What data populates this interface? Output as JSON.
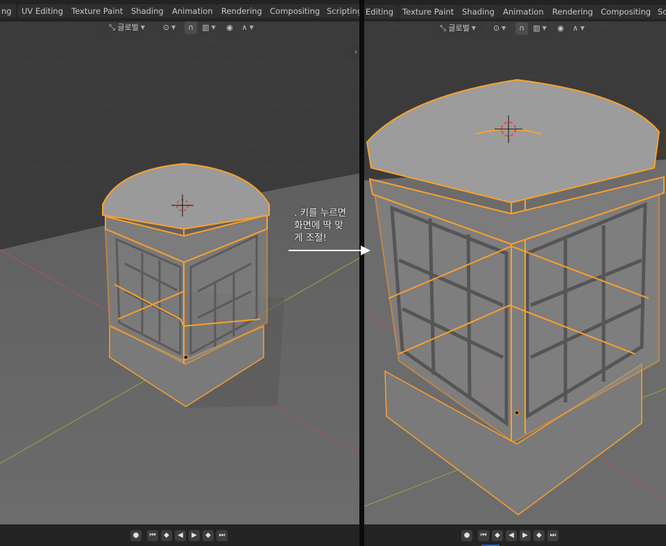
{
  "workspace_tabs_left": [
    "ng",
    "UV Editing",
    "Texture Paint",
    "Shading",
    "Animation",
    "Rendering",
    "Compositing",
    "Scripting"
  ],
  "workspace_tabs_right": [
    "Editing",
    "Texture Paint",
    "Shading",
    "Animation",
    "Rendering",
    "Compositing",
    "Sc"
  ],
  "toolbar": {
    "transform_orientation": "글로벌",
    "pivot_icon": "pivot-point-icon",
    "snap_icon": "snap-magnet-icon",
    "proportional_icon": "proportional-edit-icon",
    "falloff_icon": "falloff-curve-icon"
  },
  "annotation": {
    "line1": ". 키를 누르면",
    "line2": "화면에 딱 맞",
    "line3": "게 조절!"
  },
  "timeline": {
    "record": "●",
    "jump_start": "⏮",
    "prev_key": "◆",
    "play_reverse": "◀",
    "play": "▶",
    "next_key": "◆",
    "jump_end": "⏭"
  },
  "colors": {
    "selection": "#ffa02a",
    "x_axis": "#b0535f",
    "y_axis": "#86b43a",
    "background": "#3a3a3a",
    "floor": "#6e6e6e"
  }
}
